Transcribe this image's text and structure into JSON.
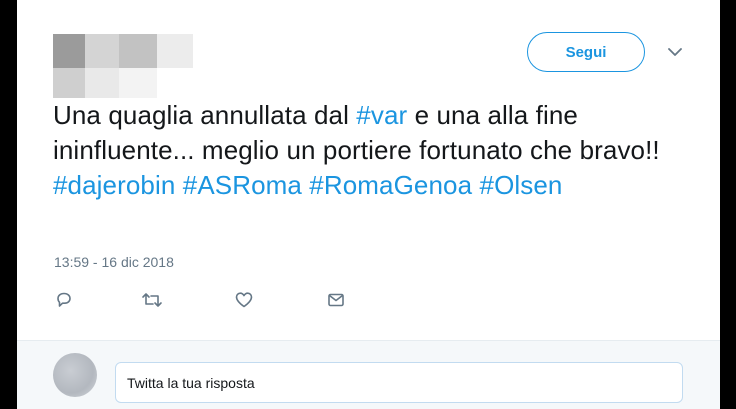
{
  "header": {
    "follow_label": "Segui"
  },
  "tweet": {
    "text_segments": [
      {
        "text": "Una quaglia annullata dal "
      },
      {
        "text": "#var",
        "hashtag": true
      },
      {
        "text": " e una alla fine ininfluente... meglio un portiere fortunato che bravo!! "
      },
      {
        "text": "#dajerobin",
        "hashtag": true
      },
      {
        "text": " "
      },
      {
        "text": "#ASRoma",
        "hashtag": true
      },
      {
        "text": " "
      },
      {
        "text": "#RomaGenoa",
        "hashtag": true
      },
      {
        "text": " "
      },
      {
        "text": "#Olsen",
        "hashtag": true
      }
    ],
    "timestamp": "13:59 - 16 dic 2018"
  },
  "actions": [
    {
      "name": "reply",
      "icon": "reply-icon"
    },
    {
      "name": "retweet",
      "icon": "retweet-icon"
    },
    {
      "name": "like",
      "icon": "heart-icon"
    },
    {
      "name": "direct-message",
      "icon": "envelope-icon"
    }
  ],
  "reply": {
    "placeholder": "Twitta la tua risposta"
  },
  "colors": {
    "accent": "#1b95e0",
    "text": "#14171a",
    "muted": "#657786",
    "reply_bg": "#f5f8fa"
  }
}
